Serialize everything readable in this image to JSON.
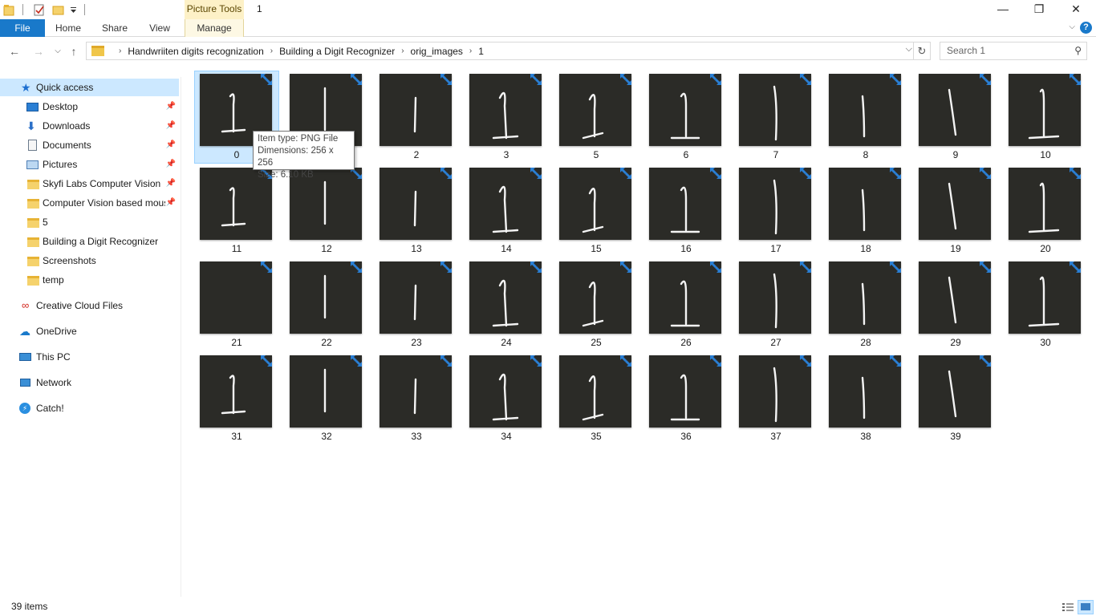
{
  "titlebar": {
    "contextual_tab": "Picture Tools",
    "window_title": "1",
    "minimize": "—",
    "maximize": "❐",
    "close": "✕"
  },
  "ribbon": {
    "tabs": [
      "File",
      "Home",
      "Share",
      "View",
      "Manage"
    ]
  },
  "address": {
    "crumbs": [
      "Handwriiten digits recognization",
      "Building a Digit Recognizer",
      "orig_images",
      "1"
    ],
    "search_placeholder": "Search 1"
  },
  "nav": {
    "quick_access": "Quick access",
    "pinned": [
      "Desktop",
      "Downloads",
      "Documents",
      "Pictures",
      "Skyfi Labs Computer Vision",
      "Computer Vision based mous"
    ],
    "recent": [
      "5",
      "Building a Digit Recognizer",
      "Screenshots",
      "temp"
    ],
    "roots": [
      "Creative Cloud Files",
      "OneDrive",
      "This PC",
      "Network",
      "Catch!"
    ]
  },
  "files": [
    "0",
    "1",
    "2",
    "3",
    "5",
    "6",
    "7",
    "8",
    "9",
    "10",
    "11",
    "12",
    "13",
    "14",
    "15",
    "16",
    "17",
    "18",
    "19",
    "20",
    "21",
    "22",
    "23",
    "24",
    "25",
    "26",
    "27",
    "28",
    "29",
    "30",
    "31",
    "32",
    "33",
    "34",
    "35",
    "36",
    "37",
    "38",
    "39"
  ],
  "tooltip": {
    "type": "Item type: PNG File",
    "dims": "Dimensions: 256 x 256",
    "size": "Size: 6.10 KB"
  },
  "status": {
    "count": "39 items"
  },
  "colors": {
    "accent": "#1979ca",
    "selection": "#cce8ff",
    "thumb_bg": "#2b2b27"
  }
}
